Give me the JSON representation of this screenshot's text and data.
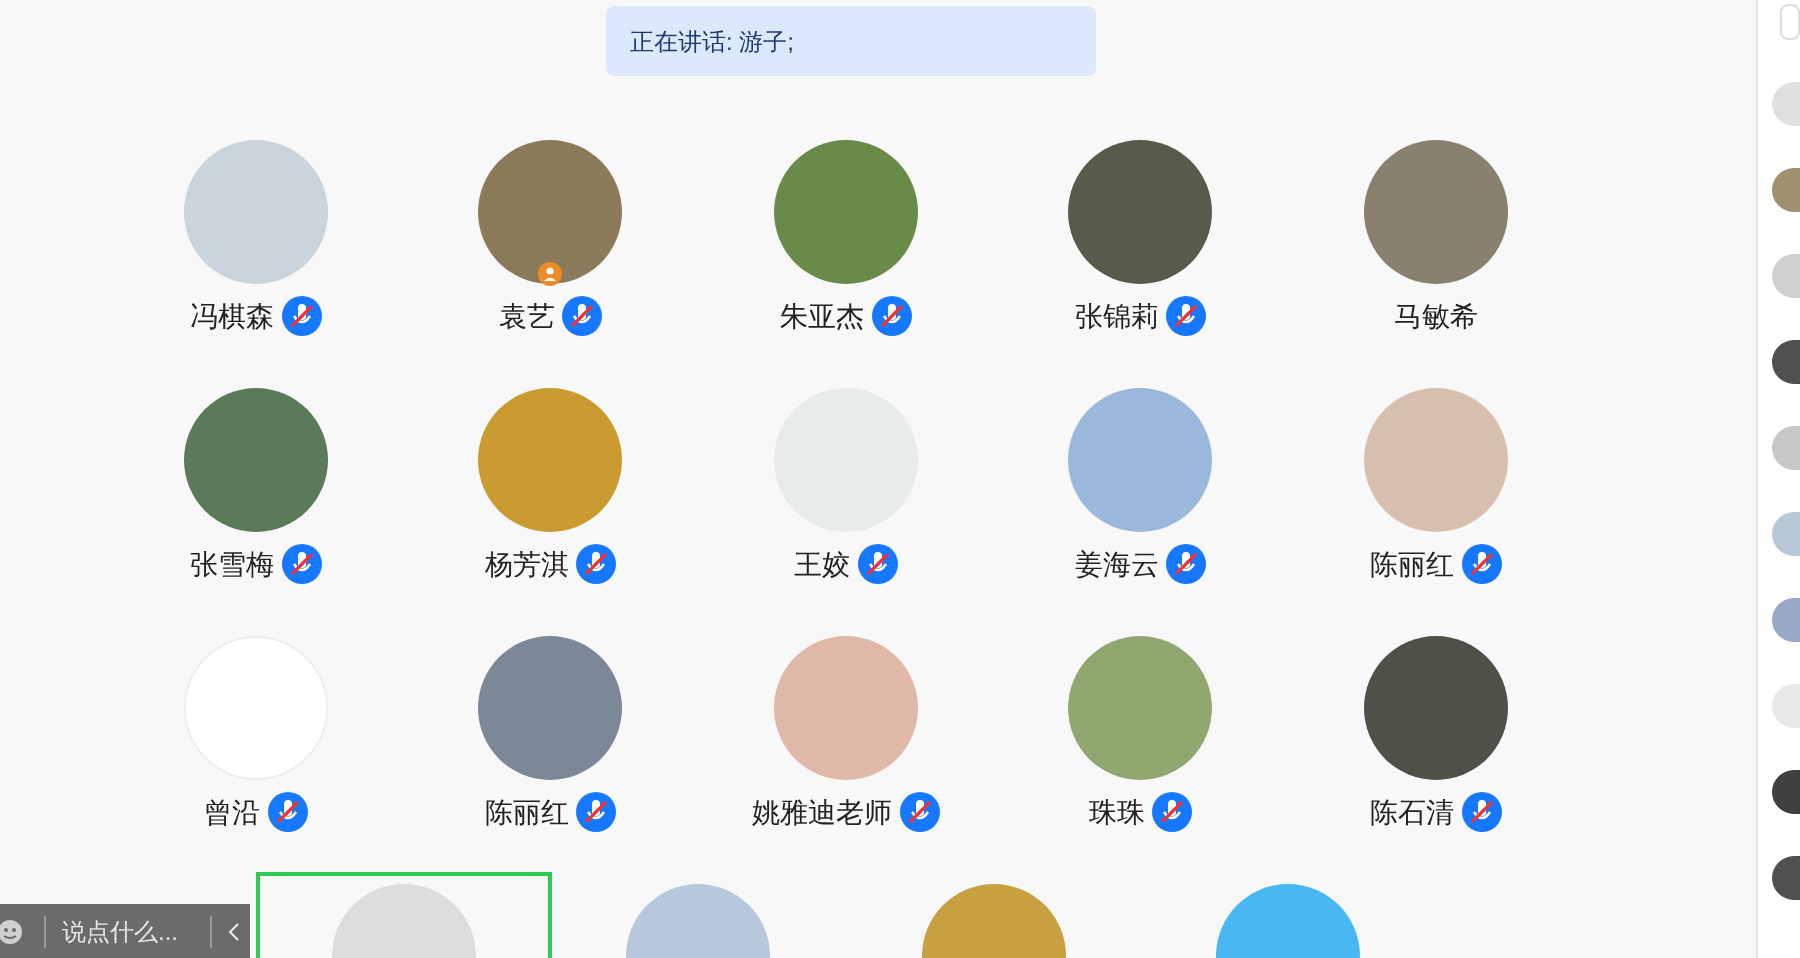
{
  "speaking_banner": "正在讲话: 游子;",
  "participants": [
    {
      "name": "冯棋森",
      "muted": true,
      "host": false
    },
    {
      "name": "袁艺",
      "muted": true,
      "host": true
    },
    {
      "name": "朱亚杰",
      "muted": true,
      "host": false
    },
    {
      "name": "张锦莉",
      "muted": true,
      "host": false
    },
    {
      "name": "马敏希",
      "muted": false,
      "host": false
    },
    {
      "name": "张雪梅",
      "muted": true,
      "host": false
    },
    {
      "name": "杨芳淇",
      "muted": true,
      "host": false
    },
    {
      "name": "王姣",
      "muted": true,
      "host": false
    },
    {
      "name": "姜海云",
      "muted": true,
      "host": false
    },
    {
      "name": "陈丽红",
      "muted": true,
      "host": false
    },
    {
      "name": "曾沿",
      "muted": true,
      "host": false
    },
    {
      "name": "陈丽红",
      "muted": true,
      "host": false
    },
    {
      "name": "姚雅迪老师",
      "muted": true,
      "host": false
    },
    {
      "name": "珠珠",
      "muted": true,
      "host": false
    },
    {
      "name": "陈石清",
      "muted": true,
      "host": false
    }
  ],
  "bottom_row": [
    {
      "selected": true
    },
    {
      "selected": false
    },
    {
      "selected": false
    },
    {
      "selected": false
    }
  ],
  "chat_bar": {
    "placeholder": "说点什么..."
  }
}
